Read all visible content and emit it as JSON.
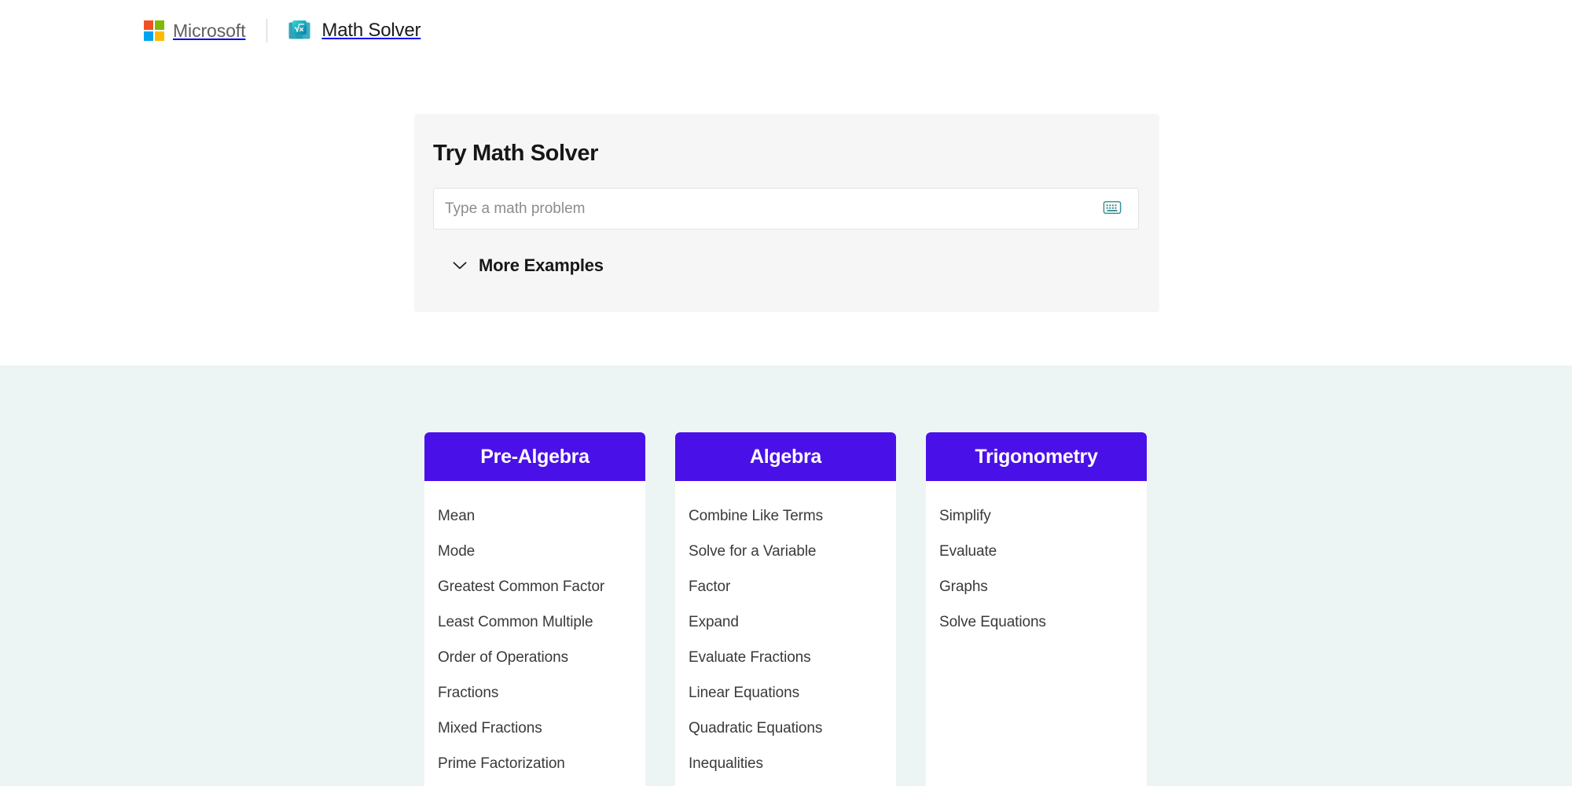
{
  "header": {
    "microsoft_label": "Microsoft",
    "app_label": "Math Solver",
    "app_icon": "math-solver-icon",
    "logo_colors": {
      "red": "#F25022",
      "green": "#7FBA00",
      "blue": "#00A4EF",
      "yellow": "#FFB900"
    }
  },
  "solver": {
    "title": "Try Math Solver",
    "input_placeholder": "Type a math problem",
    "input_value": "",
    "keyboard_icon": "keyboard-icon",
    "keyboard_icon_color": "#3f8f8f",
    "more_examples_label": "More Examples",
    "more_examples_icon": "chevron-down-icon",
    "card_background": "#f6f6f6"
  },
  "categories": {
    "section_background": "#edf5f4",
    "header_color": "#4a10e8",
    "columns": [
      {
        "title": "Pre-Algebra",
        "items": [
          "Mean",
          "Mode",
          "Greatest Common Factor",
          "Least Common Multiple",
          "Order of Operations",
          "Fractions",
          "Mixed Fractions",
          "Prime Factorization"
        ]
      },
      {
        "title": "Algebra",
        "items": [
          "Combine Like Terms",
          "Solve for a Variable",
          "Factor",
          "Expand",
          "Evaluate Fractions",
          "Linear Equations",
          "Quadratic Equations",
          "Inequalities"
        ]
      },
      {
        "title": "Trigonometry",
        "items": [
          "Simplify",
          "Evaluate",
          "Graphs",
          "Solve Equations"
        ]
      }
    ]
  }
}
